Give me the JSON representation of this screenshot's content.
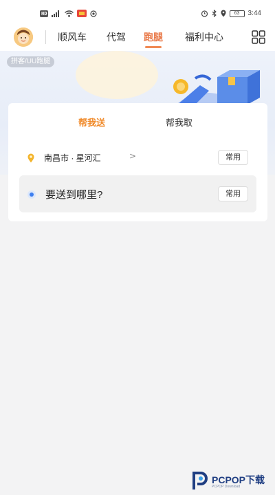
{
  "status_bar": {
    "hd_badge": "HD",
    "network": "4G",
    "battery": "63",
    "time": "3:44"
  },
  "nav": {
    "tabs": [
      {
        "label": "顺风车",
        "active": false
      },
      {
        "label": "代驾",
        "active": false
      },
      {
        "label": "跑腿",
        "active": true
      },
      {
        "label": "福利中心",
        "active": false
      }
    ],
    "accent_color": "#e97a4a"
  },
  "banner": {
    "tag": "拼客/UU跑腿"
  },
  "card": {
    "segments": [
      {
        "label": "帮我送",
        "active": true
      },
      {
        "label": "帮我取",
        "active": false
      }
    ],
    "from": {
      "location": "南昌市 · 星河汇",
      "chevron": ">",
      "common_label": "常用"
    },
    "to": {
      "placeholder": "要送到哪里?",
      "common_label": "常用"
    }
  },
  "watermark": {
    "brand": "PCPOP下载",
    "sub": "PCPOP Download"
  },
  "icons": {
    "avatar": "avatar-icon",
    "grid": "grid-menu-icon",
    "pin": "location-pin-icon",
    "dot": "destination-dot-icon"
  }
}
